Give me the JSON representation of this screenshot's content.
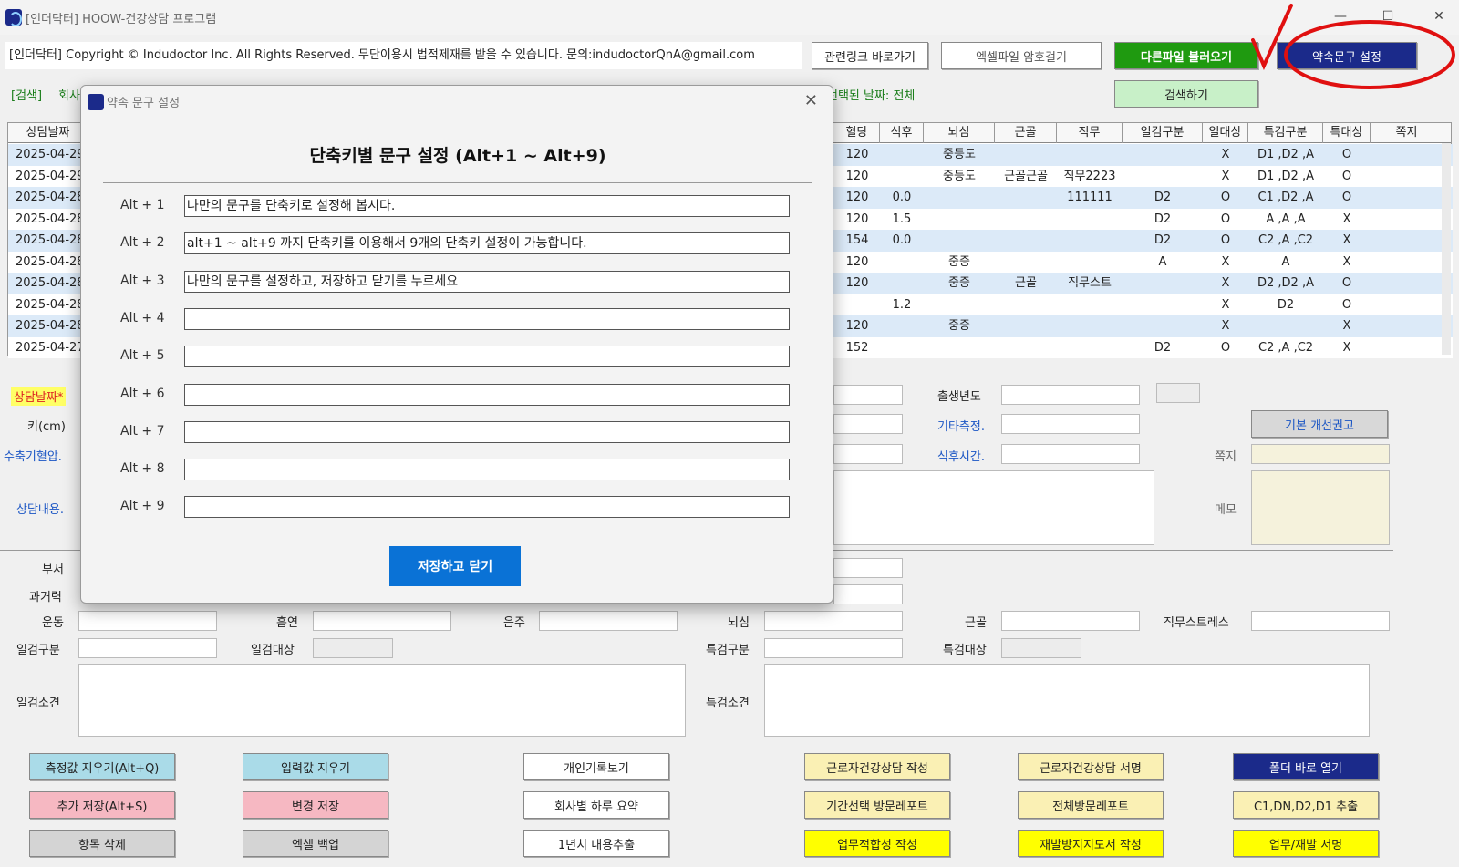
{
  "window": {
    "title": "[인더닥터] HOOW-건강상담 프로그램"
  },
  "header": {
    "copyright": "[인더닥터] Copyright © Indudoctor Inc. All Rights Reserved. 무단이용시 법적제재를 받을 수 있습니다. 문의:indudoctorQnA@gmail.com",
    "related_link": "관련링크 바로가기",
    "excel_password": "엑셀파일 암호걸기",
    "load_other_file": "다른파일 불러오기",
    "phrase_settings": "약속문구 설정",
    "search_label": "[검색]",
    "search_company": "회사",
    "selected_date": "선택된 날짜: 전체",
    "search_button": "검색하기"
  },
  "table": {
    "headers": [
      "상담날짜",
      "혈당",
      "식후",
      "뇌심",
      "근골",
      "직무",
      "일검구분",
      "일대상",
      "특검구분",
      "특대상",
      "쪽지"
    ],
    "rows": [
      {
        "date": "2025-04-29",
        "blood_sugar": "120",
        "after_meal": "",
        "cardio": "중등도",
        "musculo": "",
        "job": "",
        "gen_type": "",
        "gen_target": "X",
        "spec_type": "D1 ,D2 ,A",
        "spec_target": "O"
      },
      {
        "date": "2025-04-29",
        "blood_sugar": "120",
        "after_meal": "",
        "cardio": "중등도",
        "musculo": "근골근골",
        "job": "직무2223",
        "gen_type": "",
        "gen_target": "X",
        "spec_type": "D1 ,D2 ,A",
        "spec_target": "O"
      },
      {
        "date": "2025-04-28",
        "blood_sugar": "120",
        "after_meal": "0.0",
        "cardio": "",
        "musculo": "",
        "job": "111111",
        "gen_type": "D2",
        "gen_target": "O",
        "spec_type": "C1 ,D2 ,A",
        "spec_target": "O"
      },
      {
        "date": "2025-04-28",
        "blood_sugar": "120",
        "after_meal": "1.5",
        "cardio": "",
        "musculo": "",
        "job": "",
        "gen_type": "D2",
        "gen_target": "O",
        "spec_type": "A ,A ,A",
        "spec_target": "X"
      },
      {
        "date": "2025-04-28",
        "blood_sugar": "154",
        "after_meal": "0.0",
        "cardio": "",
        "musculo": "",
        "job": "",
        "gen_type": "D2",
        "gen_target": "O",
        "spec_type": "C2 ,A ,C2",
        "spec_target": "X"
      },
      {
        "date": "2025-04-28",
        "blood_sugar": "120",
        "after_meal": "",
        "cardio": "중증",
        "musculo": "",
        "job": "",
        "gen_type": "A",
        "gen_target": "X",
        "spec_type": "A",
        "spec_target": "X"
      },
      {
        "date": "2025-04-28",
        "blood_sugar": "120",
        "after_meal": "",
        "cardio": "중증",
        "musculo": "근골",
        "job": "직무스트",
        "gen_type": "",
        "gen_target": "X",
        "spec_type": "D2 ,D2 ,A",
        "spec_target": "O"
      },
      {
        "date": "2025-04-28",
        "blood_sugar": "",
        "after_meal": "1.2",
        "cardio": "",
        "musculo": "",
        "job": "",
        "gen_type": "",
        "gen_target": "X",
        "spec_type": "D2",
        "spec_target": "O"
      },
      {
        "date": "2025-04-28",
        "blood_sugar": "120",
        "after_meal": "",
        "cardio": "중증",
        "musculo": "",
        "job": "",
        "gen_type": "",
        "gen_target": "X",
        "spec_type": "",
        "spec_target": "X"
      },
      {
        "date": "2025-04-27",
        "blood_sugar": "152",
        "after_meal": "",
        "cardio": "",
        "musculo": "",
        "job": "",
        "gen_type": "D2",
        "gen_target": "O",
        "spec_type": "C2 ,A ,C2",
        "spec_target": "X"
      }
    ]
  },
  "form": {
    "consult_date": "상담날짜*",
    "height": "키(cm)",
    "systolic": "수축기혈압.",
    "consult_content": "상담내용.",
    "birth_year": "출생년도",
    "other_measure": "기타측정.",
    "after_meal_time": "식후시간.",
    "basic_advice": "기본 개선권고",
    "note": "쪽지",
    "memo": "메모",
    "department": "부서",
    "history": "과거력",
    "exercise": "운동",
    "smoking": "흡연",
    "drinking": "음주",
    "cardio": "뇌심",
    "musculo": "근골",
    "job_stress": "직무스트레스",
    "gen_type": "일검구분",
    "gen_target": "일검대상",
    "spec_type": "특검구분",
    "spec_target": "특검대상",
    "gen_opinion": "일검소견",
    "spec_opinion": "특검소견"
  },
  "buttons": {
    "clear_measure": "측정값 지우기(Alt+Q)",
    "clear_input": "입력값 지우기",
    "personal_record": "개인기록보기",
    "worker_consult_write": "근로자건강상담 작성",
    "worker_consult_sign": "근로자건강상담 서명",
    "open_folder": "폴더 바로 열기",
    "add_save": "추가 저장(Alt+S)",
    "change_save": "변경 저장",
    "company_daily": "회사별 하루 요약",
    "period_report": "기간선택 방문레포트",
    "all_report": "전체방문레포트",
    "extract": "C1,DN,D2,D1 추출",
    "delete_item": "항목 삭제",
    "excel_backup": "엑셀 백업",
    "year_extract": "1년치 내용추출",
    "fitness_write": "업무적합성 작성",
    "prevention_write": "재발방지지도서 작성",
    "work_sign": "업무/재발 서명"
  },
  "modal": {
    "title": "약속 문구 설정",
    "heading": "단축키별 문구 설정 (Alt+1 ~ Alt+9)",
    "rows": [
      {
        "label": "Alt + 1",
        "value": "나만의 문구를 단축키로 설정해 봅시다."
      },
      {
        "label": "Alt + 2",
        "value": "alt+1 ~ alt+9 까지 단축키를 이용해서 9개의 단축키 설정이 가능합니다."
      },
      {
        "label": "Alt + 3",
        "value": "나만의 문구를 설정하고, 저장하고 닫기를 누르세요"
      },
      {
        "label": "Alt + 4",
        "value": ""
      },
      {
        "label": "Alt + 5",
        "value": ""
      },
      {
        "label": "Alt + 6",
        "value": ""
      },
      {
        "label": "Alt + 7",
        "value": ""
      },
      {
        "label": "Alt + 8",
        "value": ""
      },
      {
        "label": "Alt + 9",
        "value": ""
      }
    ],
    "save_close": "저장하고 닫기"
  },
  "colors": {
    "green_btn": "#1f9a10",
    "navy_btn": "#1b2a8a",
    "annotation": "#e01010",
    "save_blue": "#0a72d6"
  }
}
